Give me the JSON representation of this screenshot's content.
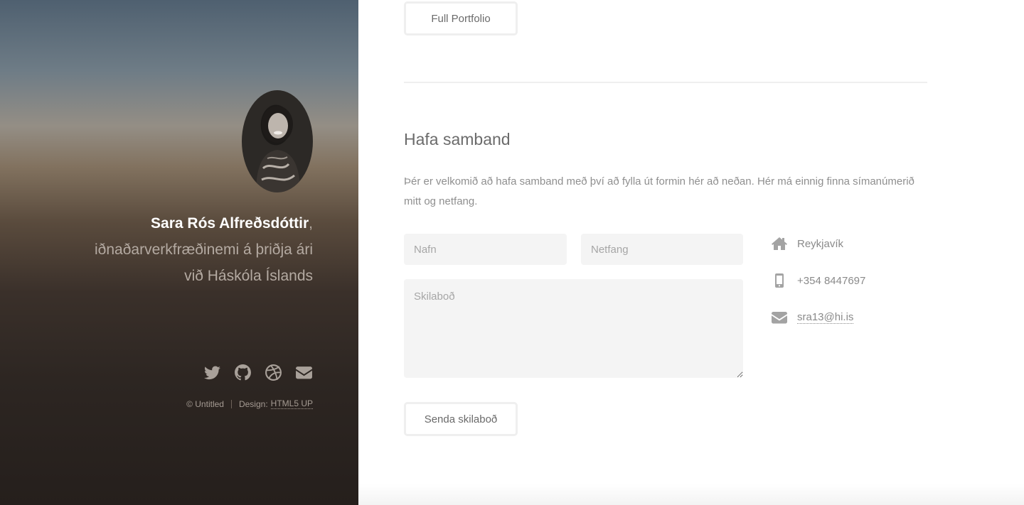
{
  "sidebar": {
    "avatar_alt": "Sara Rós Alfreðsdóttir",
    "name": "Sara Rós Alfreðsdóttir",
    "name_suffix": ",",
    "tagline_line1": "iðnaðarverkfræðinemi á þriðja ári",
    "tagline_line2": "við Háskóla Íslands",
    "socials": [
      {
        "icon": "twitter-icon"
      },
      {
        "icon": "github-icon"
      },
      {
        "icon": "dribbble-icon"
      },
      {
        "icon": "envelope-icon"
      }
    ],
    "copyright": "© Untitled",
    "design_label": "Design:",
    "design_link": "HTML5 UP"
  },
  "main": {
    "portfolio_button": "Full Portfolio",
    "contact": {
      "title": "Hafa samband",
      "text": "Þér er velkomið að hafa samband með því að fylla út formin hér að neðan. Hér má einnig finna símanúmerið mitt og netfang.",
      "form": {
        "name_placeholder": "Nafn",
        "email_placeholder": "Netfang",
        "message_placeholder": "Skilaboð",
        "submit_label": "Senda skilaboð"
      },
      "info": {
        "address": "Reykjavík",
        "phone": "+354 8447697",
        "email": "sra13@hi.is"
      }
    }
  },
  "colors": {
    "sidebar_dark": "#251f1c",
    "sidebar_top": "#4f6070",
    "text_muted": "#8f8f8f",
    "heading": "#6b6b6b",
    "field_bg": "#f4f4f4",
    "border": "#efefef"
  }
}
